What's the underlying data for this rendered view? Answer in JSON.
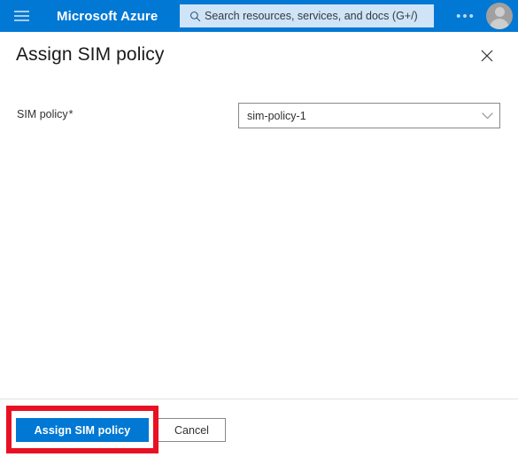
{
  "header": {
    "menu_icon": "hamburger-icon",
    "brand": "Microsoft Azure",
    "search": {
      "icon": "search-icon",
      "placeholder": "Search resources, services, and docs (G+/)",
      "value": ""
    },
    "more_label": "•••",
    "avatar_icon": "user-avatar-icon",
    "bg_color": "#0078d4",
    "search_bg_color": "#cfe4f7"
  },
  "blade": {
    "title": "Assign SIM policy",
    "close_icon": "close-icon"
  },
  "form": {
    "fields": [
      {
        "label": "SIM policy",
        "required_marker": "*",
        "control": "dropdown",
        "value": "sim-policy-1",
        "chevron_icon": "chevron-down-icon"
      }
    ]
  },
  "footer": {
    "primary_label": "Assign SIM policy",
    "secondary_label": "Cancel",
    "primary_color": "#0078d4"
  },
  "annotation": {
    "highlight_color": "#e81123",
    "target": "assign-sim-policy-button"
  }
}
